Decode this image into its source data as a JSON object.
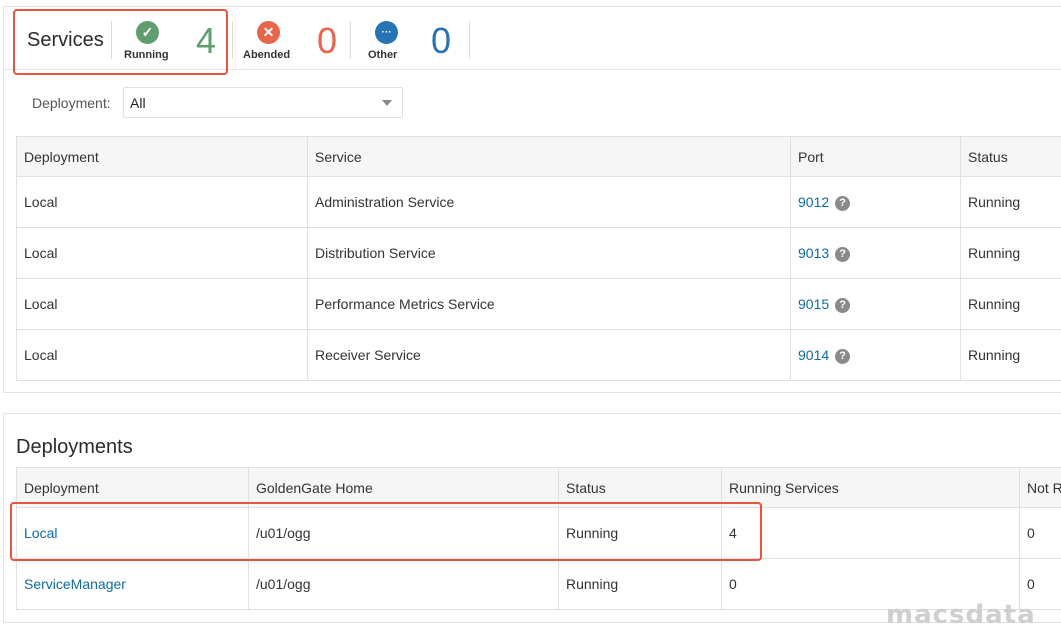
{
  "summary": {
    "title": "Services",
    "stats": [
      {
        "label": "Running",
        "count": "4",
        "icon": "check-icon",
        "glyph": "✓",
        "color": "#5f9e6e"
      },
      {
        "label": "Abended",
        "count": "0",
        "icon": "x-icon",
        "glyph": "✕",
        "color": "#e8644a"
      },
      {
        "label": "Other",
        "count": "0",
        "icon": "more-icon",
        "glyph": "···",
        "color": "#2674b5"
      }
    ]
  },
  "filter": {
    "label": "Deployment:",
    "selected": "All"
  },
  "services_table": {
    "columns": [
      "Deployment",
      "Service",
      "Port",
      "Status"
    ],
    "rows": [
      {
        "deployment": "Local",
        "service": "Administration Service",
        "port": "9012",
        "status": "Running"
      },
      {
        "deployment": "Local",
        "service": "Distribution Service",
        "port": "9013",
        "status": "Running"
      },
      {
        "deployment": "Local",
        "service": "Performance Metrics Service",
        "port": "9015",
        "status": "Running"
      },
      {
        "deployment": "Local",
        "service": "Receiver Service",
        "port": "9014",
        "status": "Running"
      }
    ]
  },
  "deployments": {
    "title": "Deployments",
    "columns": [
      "Deployment",
      "GoldenGate Home",
      "Status",
      "Running Services",
      "Not R"
    ],
    "rows": [
      {
        "deployment": "Local",
        "home": "/u01/ogg",
        "status": "Running",
        "running": "4",
        "not_running": "0"
      },
      {
        "deployment": "ServiceManager",
        "home": "/u01/ogg",
        "status": "Running",
        "running": "0",
        "not_running": "0"
      }
    ]
  },
  "watermark": "macsdata",
  "help_glyph": "?"
}
